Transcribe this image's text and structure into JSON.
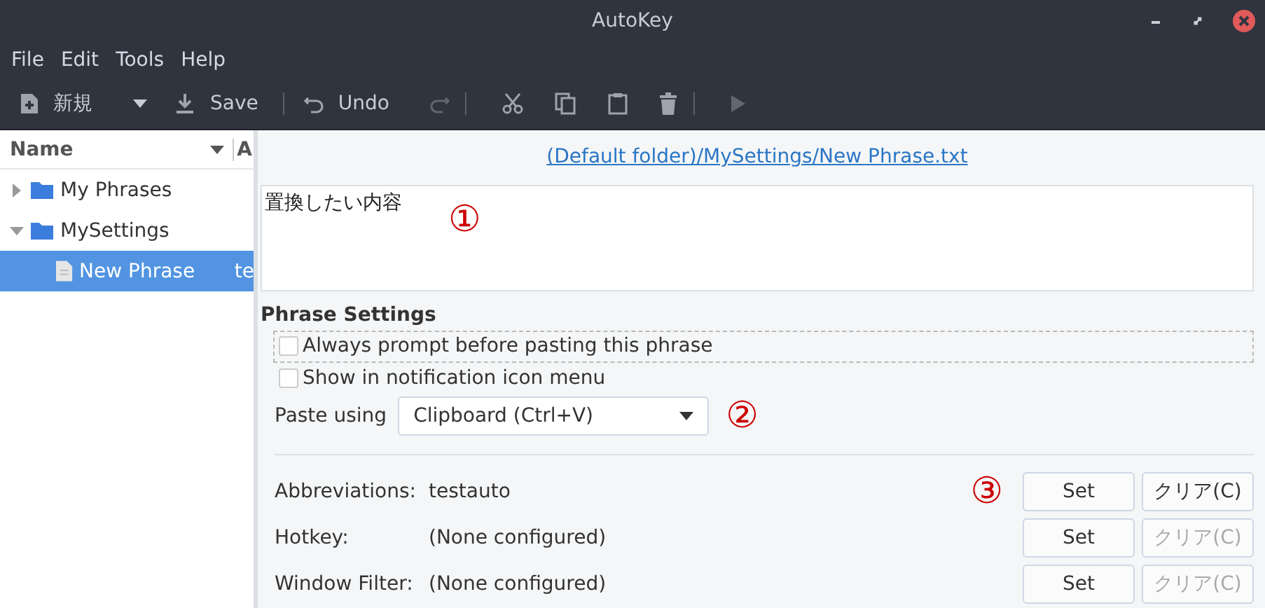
{
  "window": {
    "title": "AutoKey"
  },
  "menu": [
    "File",
    "Edit",
    "Tools",
    "Help"
  ],
  "toolbar": [
    {
      "kind": "new",
      "label": "新規",
      "disabled": false
    },
    {
      "kind": "save",
      "label": "Save",
      "disabled": false
    },
    {
      "kind": "separator"
    },
    {
      "kind": "undo",
      "label": "Undo",
      "disabled": false
    },
    {
      "kind": "redo",
      "disabled": true
    },
    {
      "kind": "separator"
    },
    {
      "kind": "cut",
      "disabled": false
    },
    {
      "kind": "copy",
      "disabled": false
    },
    {
      "kind": "paste",
      "disabled": false
    },
    {
      "kind": "delete",
      "disabled": false
    },
    {
      "kind": "separator"
    },
    {
      "kind": "run",
      "disabled": true
    }
  ],
  "tree": {
    "columns": [
      "Name",
      "A"
    ],
    "items": [
      {
        "label": "My Phrases",
        "expanded": false,
        "selected": false
      },
      {
        "label": "MySettings",
        "expanded": true,
        "selected": false,
        "children": [
          {
            "label": "New Phrase",
            "column_2": "te",
            "selected": true
          }
        ]
      }
    ]
  },
  "editor": {
    "path": "(Default folder)/MySettings/New Phrase.txt",
    "text": "置換したい内容",
    "annotation": "①"
  },
  "phrase_settings": {
    "title": "Phrase Settings",
    "options": [
      {
        "label": "Always prompt before pasting this phrase",
        "checked": false,
        "focused": true
      },
      {
        "label": "Show in notification icon menu",
        "checked": false,
        "focused": false
      }
    ],
    "paste_label": "Paste using",
    "paste_value": "Clipboard (Ctrl+V)",
    "annotation": "②"
  },
  "triggers": [
    {
      "label": "Abbreviations:",
      "value": "testauto",
      "annotation": "③",
      "set": "Set",
      "clear": "クリア(C)",
      "clear_disabled": false
    },
    {
      "label": "Hotkey:",
      "value": "(None configured)",
      "set": "Set",
      "clear": "クリア(C)",
      "clear_disabled": true
    },
    {
      "label": "Window Filter:",
      "value": "(None configured)",
      "set": "Set",
      "clear": "クリア(C)",
      "clear_disabled": true
    }
  ]
}
